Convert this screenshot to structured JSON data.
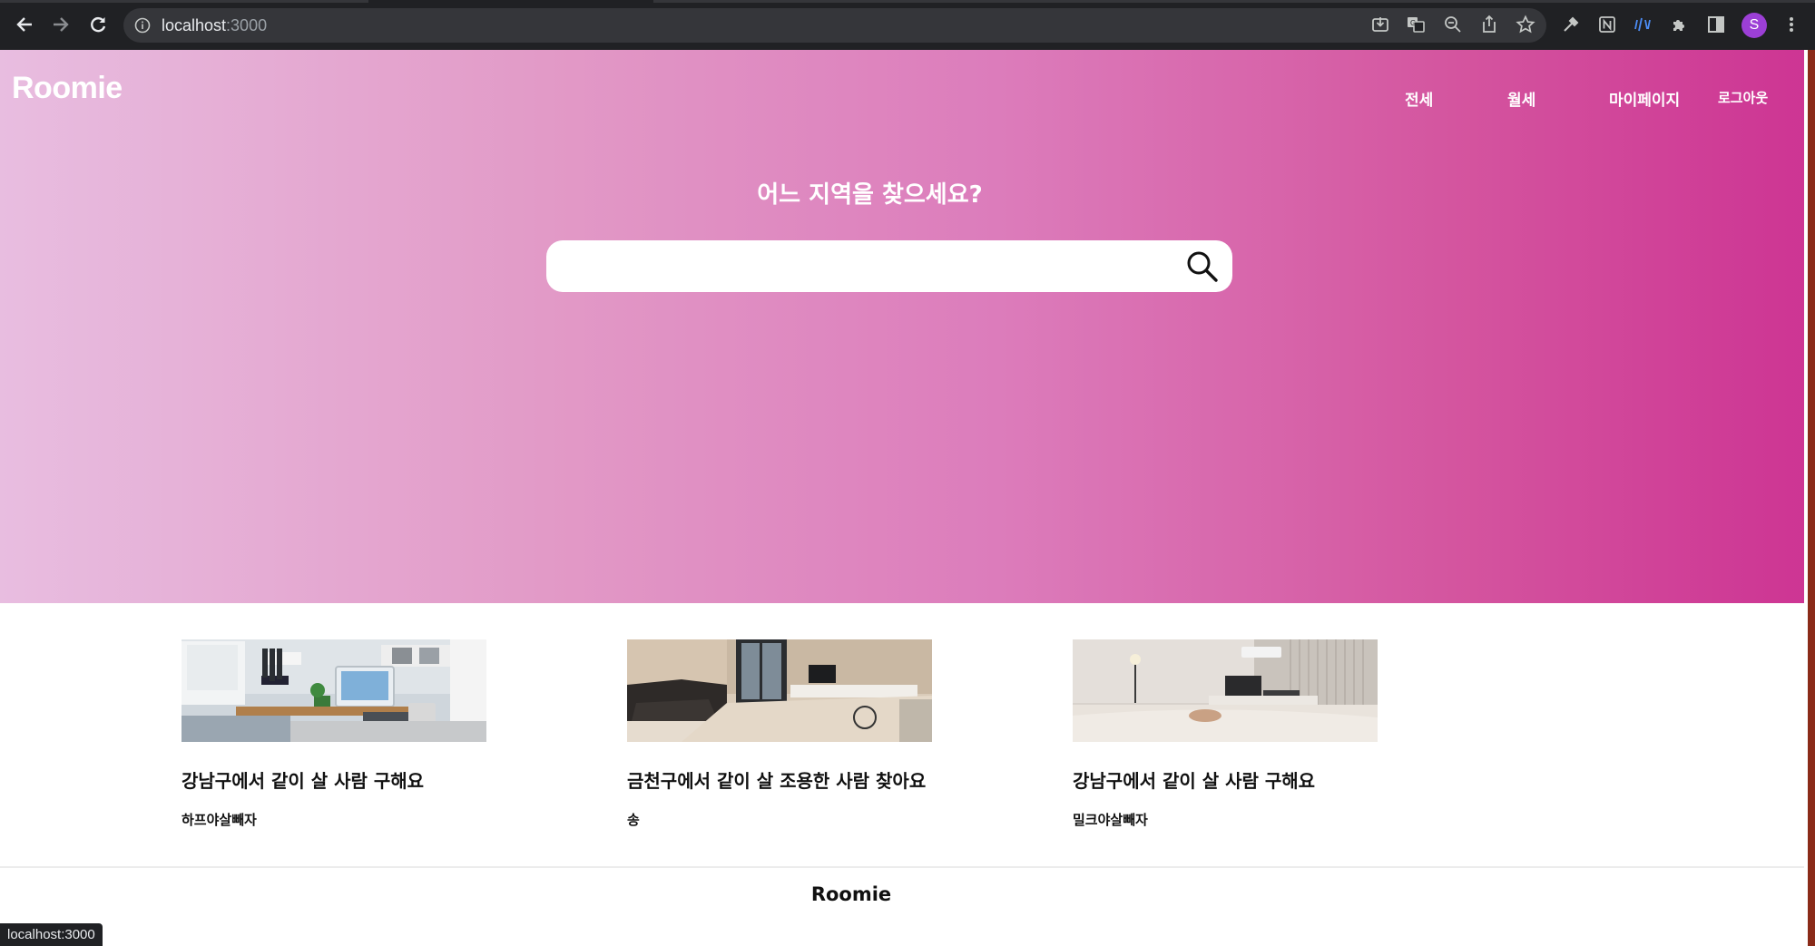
{
  "browser": {
    "url_host": "localhost",
    "url_port": ":3000",
    "profile_initial": "S",
    "status_text": "localhost:3000",
    "icons": [
      "back-icon",
      "forward-icon",
      "reload-icon",
      "info-icon",
      "install-icon",
      "translate-icon",
      "zoom-out-icon",
      "share-icon",
      "star-icon",
      "eyedropper-icon",
      "notion-icon",
      "voice-icon",
      "extensions-icon",
      "sidepanel-icon",
      "more-icon"
    ]
  },
  "header": {
    "logo": "Roomie",
    "nav": [
      "전세",
      "월세",
      "마이페이지",
      "로그아웃"
    ]
  },
  "hero": {
    "title": "어느 지역을 찾으세요?",
    "search_value": "",
    "gradient": [
      "#e8bde0",
      "#cd3493"
    ]
  },
  "cards": [
    {
      "title": "강남구에서 같이 살 사람 구해요",
      "author": "하프야살빼자",
      "image": "room-desk-photo"
    },
    {
      "title": "금천구에서 같이 살 조용한 사람 찾아요",
      "author": "송",
      "image": "living-room-sofa-photo"
    },
    {
      "title": "강남구에서 같이 살 사람 구해요",
      "author": "밀크야살빼자",
      "image": "bedroom-photo"
    }
  ],
  "footer": {
    "logo": "Roomie"
  }
}
